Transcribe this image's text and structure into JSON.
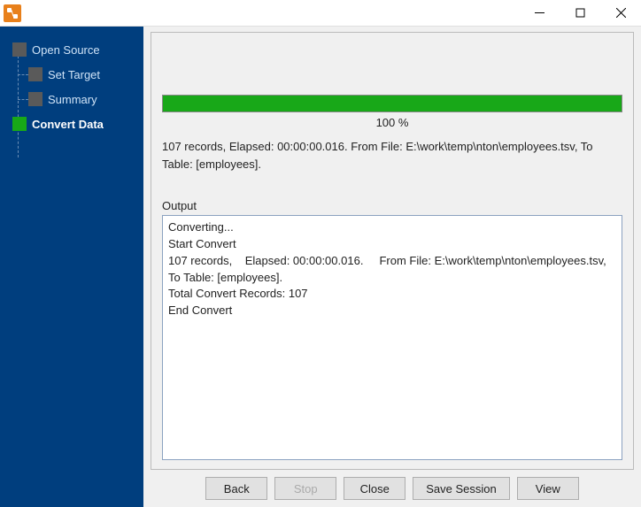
{
  "colors": {
    "sidebar": "#003e7e",
    "progress": "#18a818",
    "app_icon": "#e8801b"
  },
  "sidebar": {
    "items": [
      {
        "label": "Open Source",
        "active": false
      },
      {
        "label": "Set Target",
        "active": false
      },
      {
        "label": "Summary",
        "active": false
      },
      {
        "label": "Convert Data",
        "active": true
      }
    ]
  },
  "progress": {
    "percent_label": "100 %",
    "value": 100
  },
  "status": "107 records,    Elapsed: 00:00:00.016.     From File: E:\\work\\temp\\nton\\employees.tsv,     To Table: [employees].",
  "output": {
    "label": "Output",
    "text": "Converting...\nStart Convert\n107 records,    Elapsed: 00:00:00.016.     From File: E:\\work\\temp\\nton\\employees.tsv,     To Table: [employees].\nTotal Convert Records: 107\nEnd Convert\n"
  },
  "buttons": {
    "back": "Back",
    "stop": "Stop",
    "close": "Close",
    "save_session": "Save Session",
    "view": "View"
  }
}
